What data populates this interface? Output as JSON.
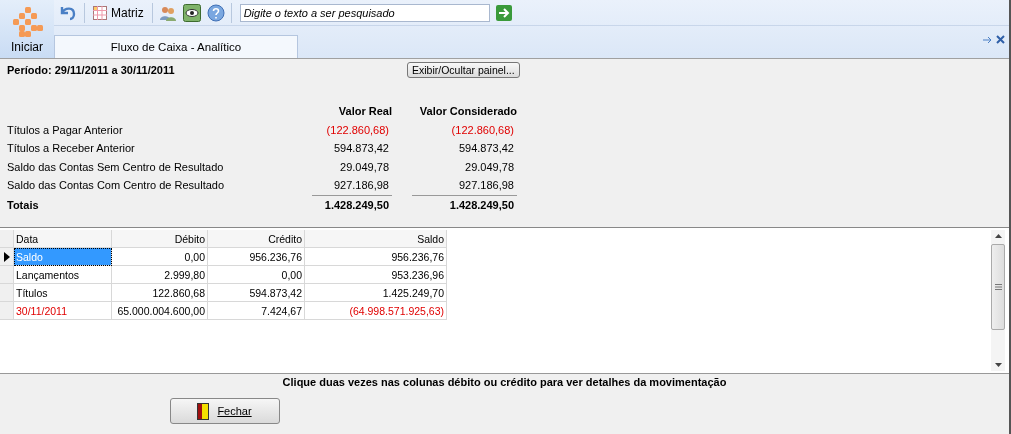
{
  "toolbar": {
    "start_label": "Iniciar",
    "matrix_label": "Matriz",
    "search": {
      "placeholder": "Digite o texto a ser pesquisado"
    }
  },
  "tabs": [
    {
      "label": "Fluxo de Caixa - Analítico",
      "selected": true
    }
  ],
  "period": "Período: 29/11/2011 a 30/11/2011",
  "toggle_button": "Exibir/Ocultar painel...",
  "summary": {
    "columns": [
      "Valor Real",
      "Valor Considerado"
    ],
    "rows": [
      {
        "label": "Títulos a Pagar Anterior",
        "values": [
          "(122.860,68)",
          "(122.860,68)"
        ],
        "negative": true
      },
      {
        "label": "Títulos a Receber Anterior",
        "values": [
          "594.873,42",
          "594.873,42"
        ],
        "negative": false
      },
      {
        "label": "Saldo das Contas Sem Centro de Resultado",
        "values": [
          "29.049,78",
          "29.049,78"
        ],
        "negative": false
      },
      {
        "label": "Saldo das Contas Com Centro de Resultado",
        "values": [
          "927.186,98",
          "927.186,98"
        ],
        "negative": false
      }
    ],
    "totals": {
      "label": "Totais",
      "values": [
        "1.428.249,50",
        "1.428.249,50"
      ]
    }
  },
  "grid": {
    "columns": [
      "Data",
      "Débito",
      "Crédito",
      "Saldo"
    ],
    "rows": [
      {
        "cells": [
          "Saldo",
          "0,00",
          "956.236,76",
          "956.236,76"
        ],
        "selected": true,
        "negative": false
      },
      {
        "cells": [
          "Lançamentos",
          "2.999,80",
          "0,00",
          "953.236,96"
        ],
        "selected": false,
        "negative": false
      },
      {
        "cells": [
          "Títulos",
          "122.860,68",
          "594.873,42",
          "1.425.249,70"
        ],
        "selected": false,
        "negative": false
      },
      {
        "cells": [
          "30/11/2011",
          "65.000.004.600,00",
          "7.424,67",
          "(64.998.571.925,63)"
        ],
        "selected": false,
        "negative": true
      }
    ]
  },
  "hint": "Clique duas vezes nas colunas débito ou crédito para ver detalhes da movimentação",
  "close_button": "Fechar"
}
